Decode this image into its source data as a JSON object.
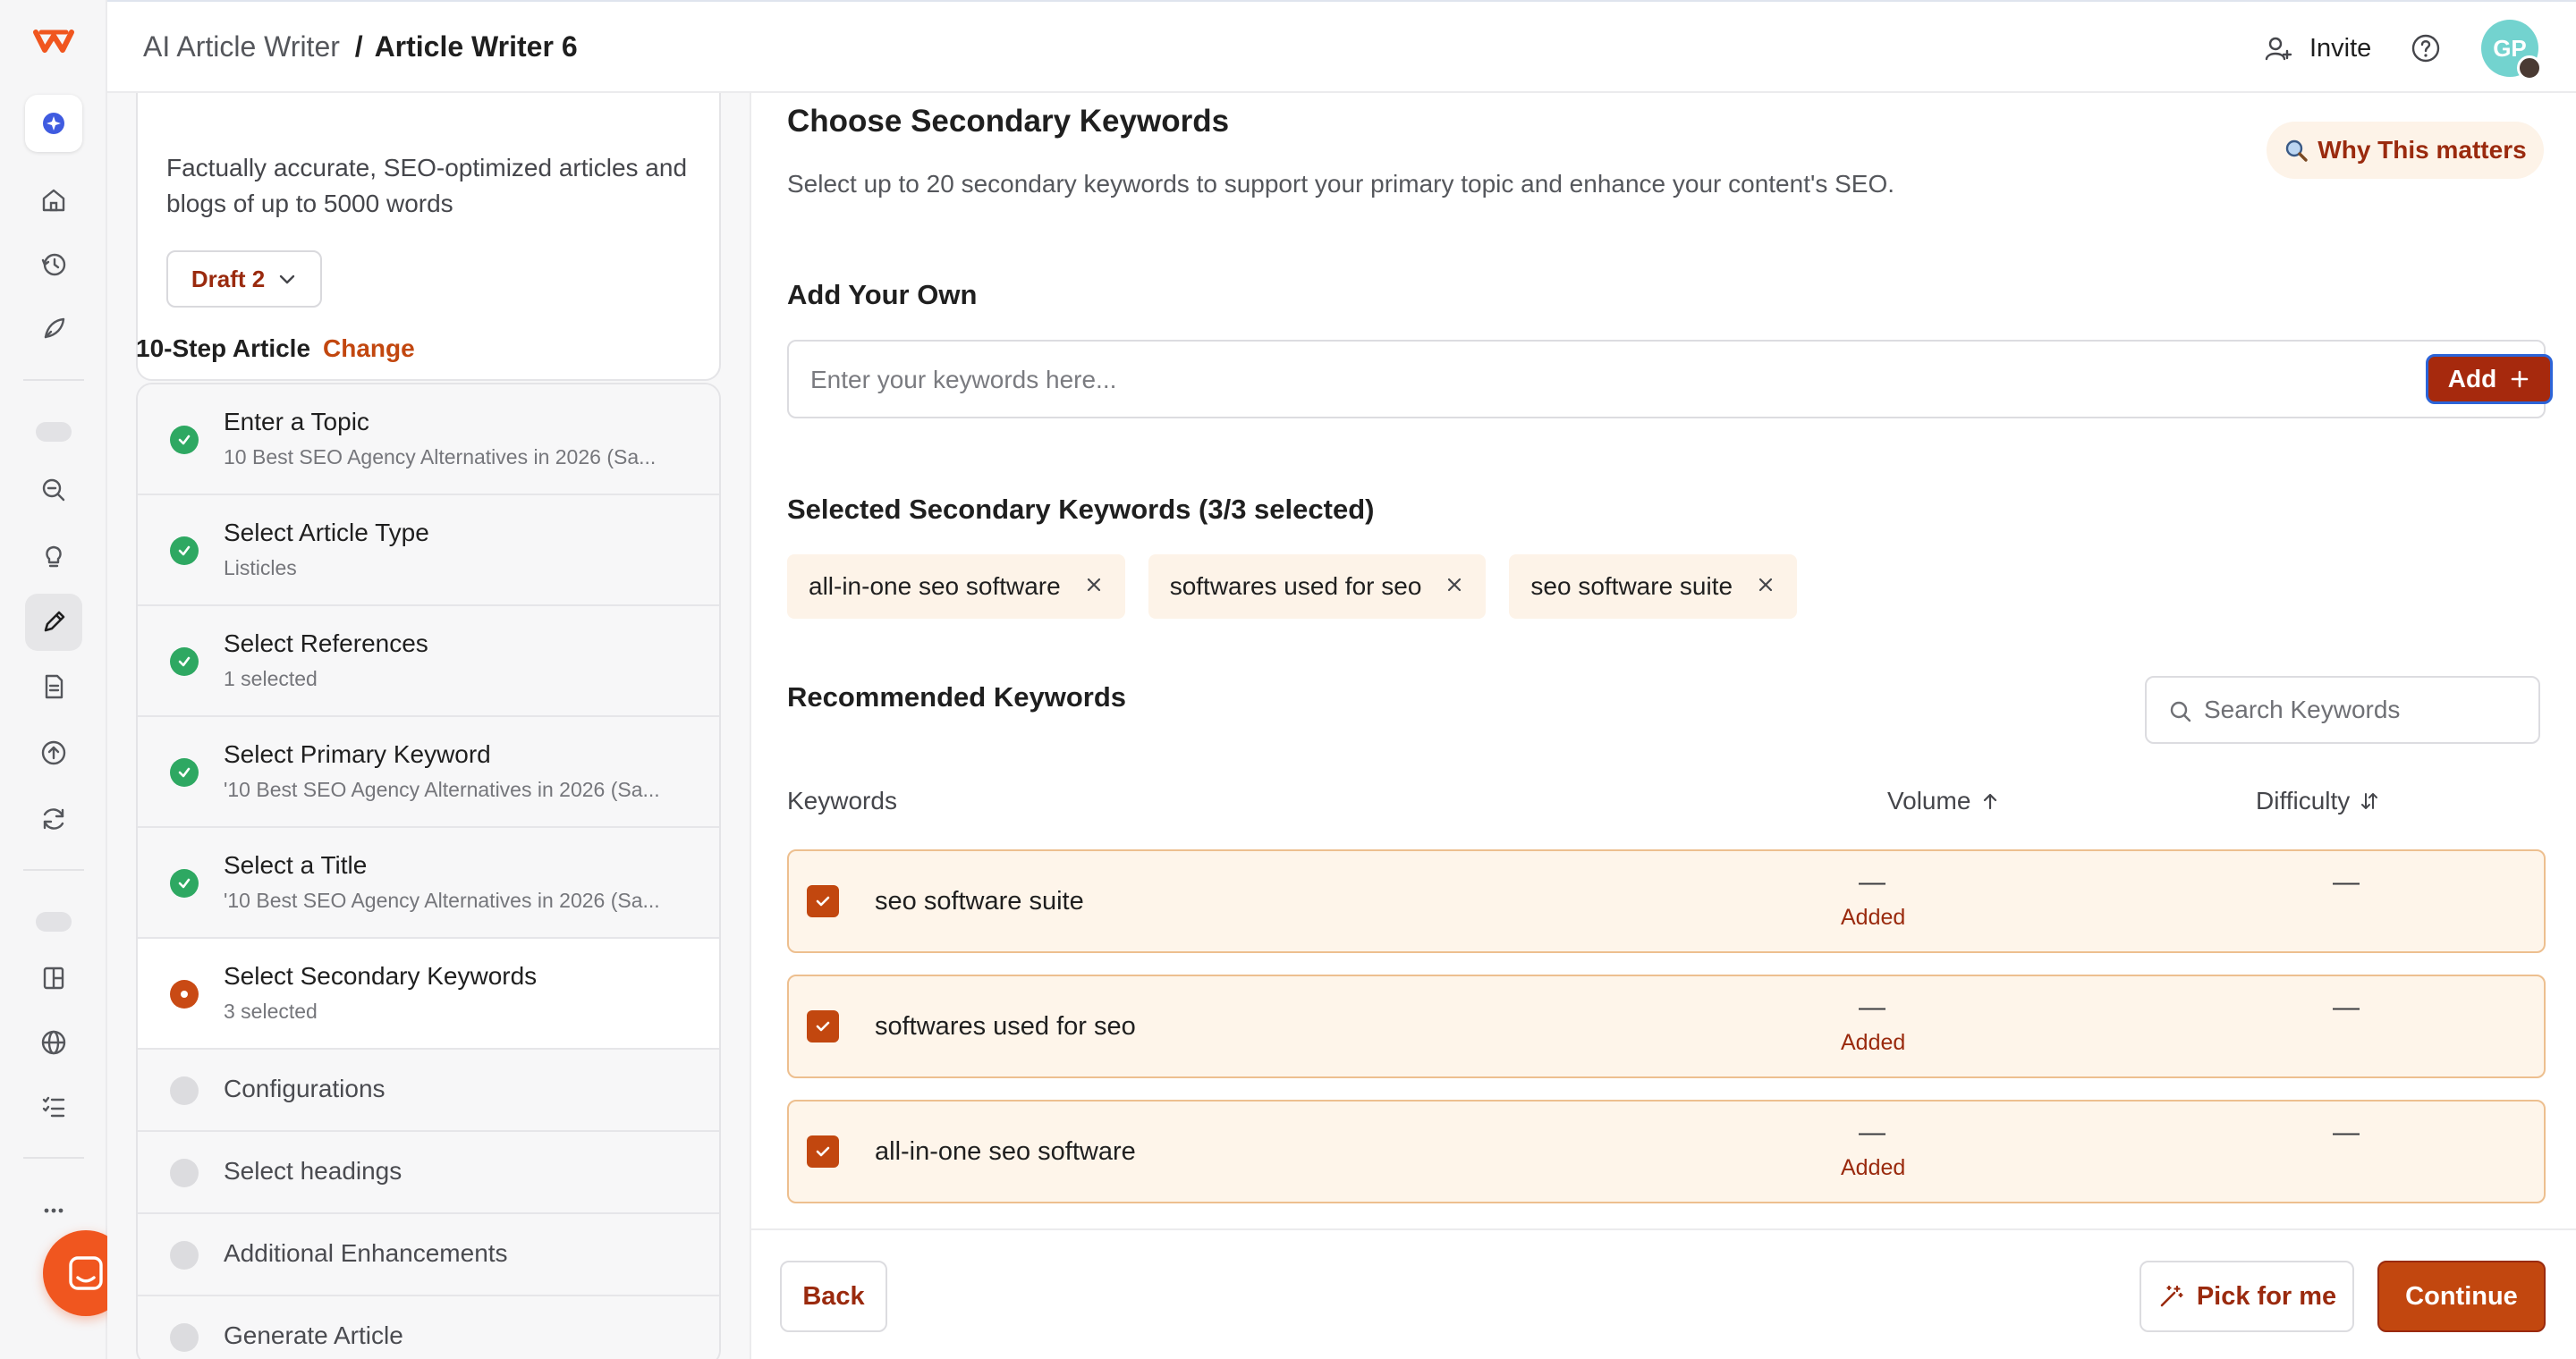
{
  "colors": {
    "accent": "#c2470f",
    "accent_dark": "#9a2a0e",
    "done_green": "#2ea862",
    "chip_bg": "#fdf3e8",
    "row_border": "#edbf8f",
    "chat_orange": "#f0561f"
  },
  "rail": {
    "logo_icon": "brand-logo-icon",
    "icons": [
      "sparkle-icon",
      "home-icon",
      "history-icon",
      "rocket-icon",
      "search-zoom-icon",
      "lightbulb-icon",
      "pen-icon",
      "document-icon",
      "upload-icon",
      "refresh-icon",
      "book-icon",
      "globe-icon",
      "checklist-icon",
      "more-icon"
    ],
    "active_icon": "pen-icon"
  },
  "header": {
    "app_name": "AI Article Writer",
    "separator": "/",
    "page_name": "Article Writer 6",
    "invite_label": "Invite",
    "avatar_initials": "GP"
  },
  "sidebar": {
    "description": "Factually accurate, SEO-optimized articles and blogs of up to 5000 words",
    "draft_label": "Draft 2",
    "steps_heading": "10-Step Article",
    "change_label": "Change",
    "steps": [
      {
        "title": "Enter a Topic",
        "subtitle": "10 Best SEO Agency Alternatives in 2026 (Sa...",
        "status": "done"
      },
      {
        "title": "Select Article Type",
        "subtitle": "Listicles",
        "status": "done"
      },
      {
        "title": "Select References",
        "subtitle": "1 selected",
        "status": "done"
      },
      {
        "title": "Select Primary Keyword",
        "subtitle": "'10 Best SEO Agency Alternatives in 2026 (Sa...",
        "status": "done"
      },
      {
        "title": "Select a Title",
        "subtitle": "'10 Best SEO Agency Alternatives in 2026 (Sa...",
        "status": "done"
      },
      {
        "title": "Select Secondary Keywords",
        "subtitle": "3 selected",
        "status": "current"
      },
      {
        "title": "Configurations",
        "subtitle": "",
        "status": "todo"
      },
      {
        "title": "Select headings",
        "subtitle": "",
        "status": "todo"
      },
      {
        "title": "Additional Enhancements",
        "subtitle": "",
        "status": "todo"
      },
      {
        "title": "Generate Article",
        "subtitle": "",
        "status": "todo"
      }
    ]
  },
  "main": {
    "title": "Choose Secondary Keywords",
    "why_label": "Why This matters",
    "description": "Select up to 20 secondary keywords to support your primary topic and enhance your content's SEO.",
    "add_heading": "Add Your Own",
    "input_placeholder": "Enter your keywords here...",
    "input_value": "",
    "add_label": "Add",
    "selected_heading": "Selected Secondary Keywords (3/3 selected)",
    "selected_chips": [
      "all-in-one seo software",
      "softwares used for seo",
      "seo software suite"
    ],
    "recommended_heading": "Recommended Keywords",
    "search_placeholder": "Search Keywords",
    "columns": {
      "keyword": "Keywords",
      "volume": "Volume",
      "difficulty": "Difficulty"
    },
    "rows": [
      {
        "keyword": "seo software suite",
        "volume": "—",
        "status": "Added",
        "difficulty": "—",
        "checked": true
      },
      {
        "keyword": "softwares used for seo",
        "volume": "—",
        "status": "Added",
        "difficulty": "—",
        "checked": true
      },
      {
        "keyword": "all-in-one seo software",
        "volume": "—",
        "status": "Added",
        "difficulty": "—",
        "checked": true
      }
    ]
  },
  "footer": {
    "back_label": "Back",
    "pick_label": "Pick for me",
    "continue_label": "Continue"
  }
}
